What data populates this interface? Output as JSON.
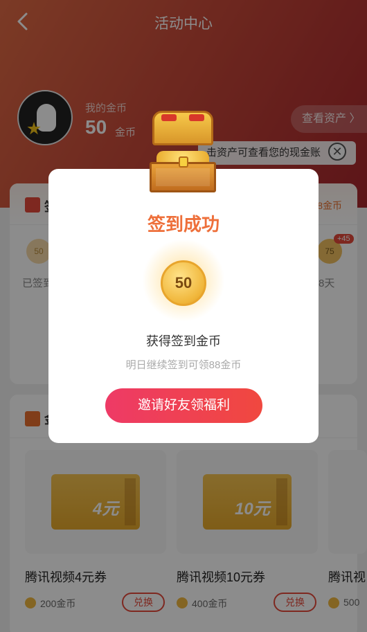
{
  "header": {
    "title": "活动中心"
  },
  "profile": {
    "coin_label": "我的金币",
    "coin_amount": "50",
    "coin_unit": "金币",
    "assets_button": "查看资产 〉"
  },
  "tooltip": {
    "text": "击资产可查看您的现金账"
  },
  "checkin_card": {
    "title": "签",
    "right_text": "8金币",
    "first_day": {
      "coin": "50",
      "label": "已签到"
    },
    "last_day": {
      "coin": "75",
      "bonus": "+45",
      "label": "8天"
    }
  },
  "exchange_card": {
    "title": "金",
    "vouchers": [
      {
        "name": "腾讯视频4元券",
        "amount": "4元",
        "price": "200金币",
        "button": "兑换"
      },
      {
        "name": "腾讯视频10元券",
        "amount": "10元",
        "price": "400金币",
        "button": "兑换"
      },
      {
        "name": "腾讯视",
        "amount": "",
        "price": "500",
        "button": ""
      }
    ]
  },
  "modal": {
    "title": "签到成功",
    "coin_value": "50",
    "got_text": "获得签到金币",
    "hint_text": "明日继续签到可领88金币",
    "invite_button": "邀请好友领福利"
  },
  "colors": {
    "accent": "#ee6f3a",
    "primary_button": "#ee3a66",
    "header_start": "#e16b45",
    "header_end": "#a8262d"
  }
}
